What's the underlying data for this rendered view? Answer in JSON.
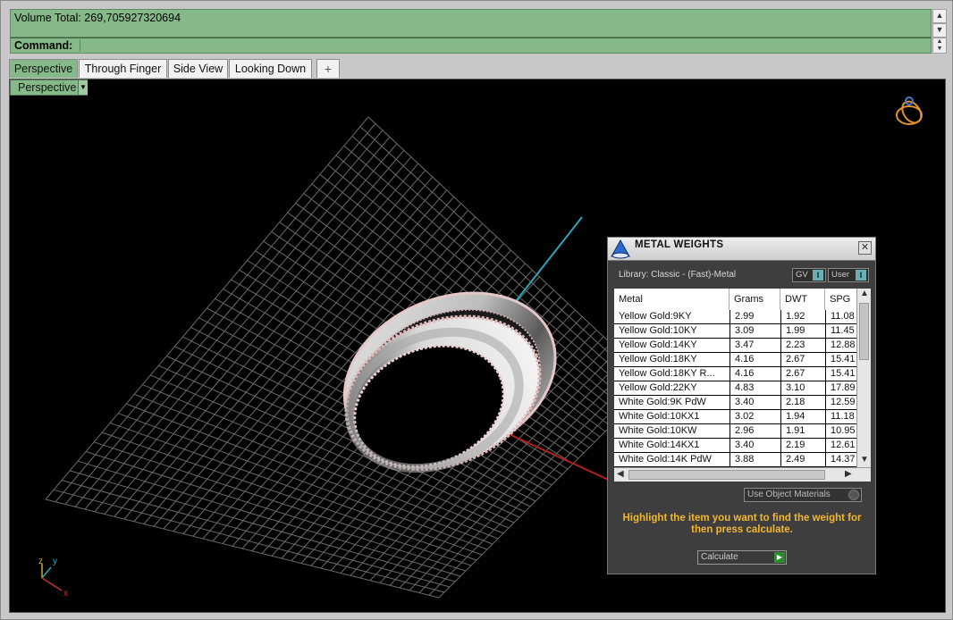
{
  "command": {
    "history_text": "Volume Total: 269,705927320694",
    "prompt_label": "Command:",
    "value": ""
  },
  "tabs": [
    {
      "label": "Perspective",
      "active": true
    },
    {
      "label": "Through Finger",
      "active": false
    },
    {
      "label": "Side View",
      "active": false
    },
    {
      "label": "Looking Down",
      "active": false
    },
    {
      "label": "+",
      "active": false
    }
  ],
  "viewport": {
    "label": "Perspective",
    "axes": {
      "x": "x",
      "y": "y",
      "z": "z"
    }
  },
  "metal_weights": {
    "title": "METAL WEIGHTS",
    "close_label": "✕",
    "library_label": "Library: Classic - (Fast)-Metal",
    "toggle_gv": "GV",
    "toggle_user": "User",
    "columns": [
      "Metal",
      "Grams",
      "DWT",
      "SPG"
    ],
    "rows": [
      [
        "Yellow Gold:9KY",
        "2.99",
        "1.92",
        "11.08"
      ],
      [
        "Yellow Gold:10KY",
        "3.09",
        "1.99",
        "11.45"
      ],
      [
        "Yellow Gold:14KY",
        "3.47",
        "2.23",
        "12.88"
      ],
      [
        "Yellow Gold:18KY",
        "4.16",
        "2.67",
        "15.41"
      ],
      [
        "Yellow Gold:18KY R...",
        "4.16",
        "2.67",
        "15.41"
      ],
      [
        "Yellow Gold:22KY",
        "4.83",
        "3.10",
        "17.89"
      ],
      [
        "White Gold:9K PdW",
        "3.40",
        "2.18",
        "12.59"
      ],
      [
        "White Gold:10KX1",
        "3.02",
        "1.94",
        "11.18"
      ],
      [
        "White Gold:10KW",
        "2.96",
        "1.91",
        "10.95"
      ],
      [
        "White Gold:14KX1",
        "3.40",
        "2.19",
        "12.61"
      ],
      [
        "White Gold:14K PdW",
        "3.88",
        "2.49",
        "14.37"
      ]
    ],
    "use_object_materials": "Use Object Materials",
    "hint": "Highlight the item you want to find the weight for then press calculate.",
    "calculate_label": "Calculate"
  }
}
